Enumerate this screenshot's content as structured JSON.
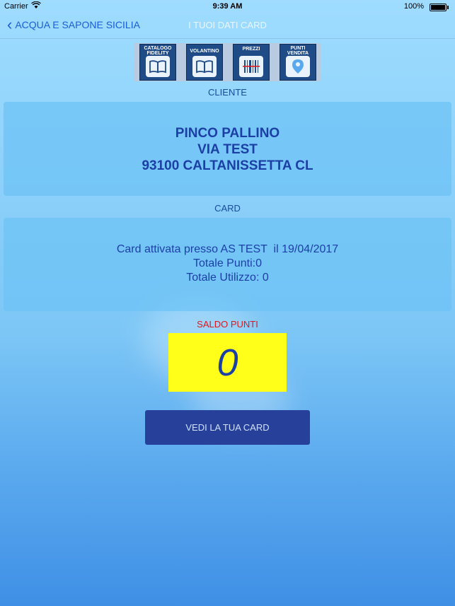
{
  "status_bar": {
    "carrier": "Carrier",
    "time": "9:39 AM",
    "battery": "100%",
    "battery_level": 1.0
  },
  "nav": {
    "back_label": "ACQUA E SAPONE SICILIA",
    "title": "I TUOI DATI CARD"
  },
  "toolbar": [
    {
      "line1": "CATALOGO",
      "line2": "FIDELITY",
      "icon": "book-icon"
    },
    {
      "line1": "VOLANTINO",
      "line2": "",
      "icon": "book-icon"
    },
    {
      "line1": "PREZZI",
      "line2": "",
      "icon": "barcode-icon"
    },
    {
      "line1": "PUNTI",
      "line2": "VENDITA",
      "icon": "map-pin-icon"
    }
  ],
  "cliente": {
    "label": "CLIENTE",
    "name": "PINCO PALLINO",
    "address": "VIA TEST",
    "city": "93100 CALTANISSETTA CL"
  },
  "card": {
    "label": "CARD",
    "activated": "Card attivata presso AS TEST  il 19/04/2017",
    "totale_punti": "Totale Punti:0",
    "totale_utilizzo": "Totale Utilizzo: 0"
  },
  "saldo": {
    "label": "SALDO PUNTI",
    "value": "0"
  },
  "button": {
    "label": "VEDI LA TUA CARD"
  },
  "colors": {
    "accent": "#27419a",
    "saldo_bg": "#ffff1a",
    "saldo_label": "#e0161c",
    "text_blue": "#1c3fa6"
  }
}
